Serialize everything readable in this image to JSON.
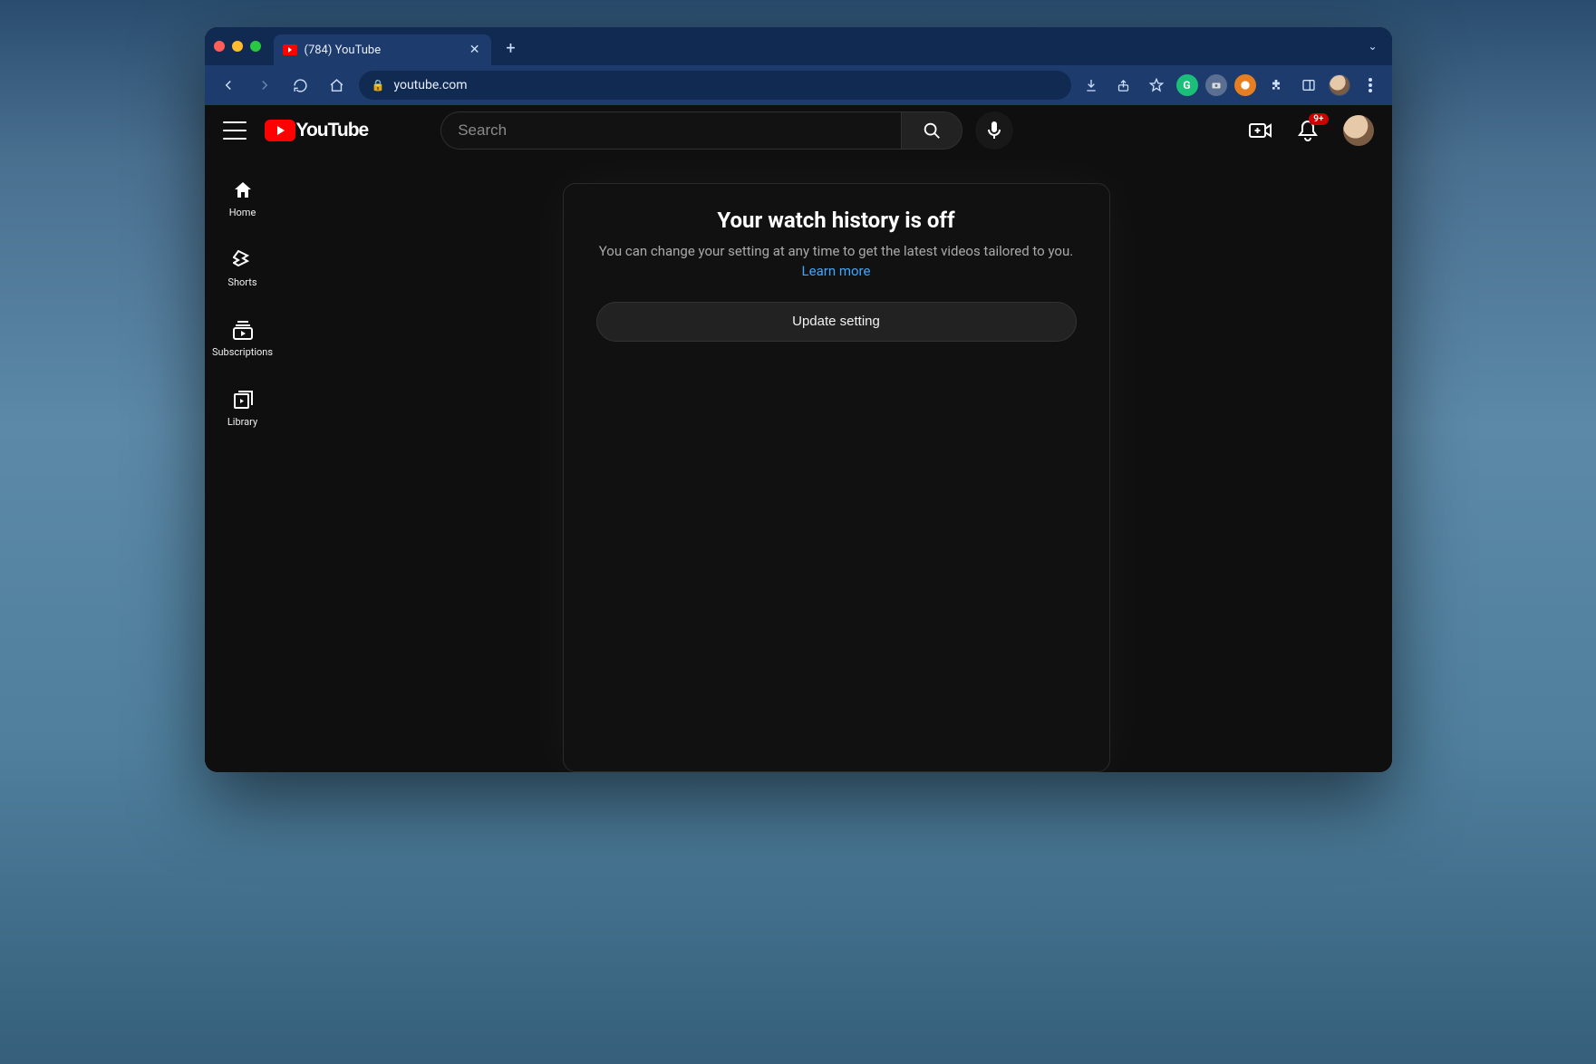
{
  "browser": {
    "tab_title": "(784) YouTube",
    "url": "youtube.com"
  },
  "masthead": {
    "logo_text": "YouTube",
    "search_placeholder": "Search",
    "notification_badge": "9+"
  },
  "sidebar": {
    "items": [
      {
        "label": "Home"
      },
      {
        "label": "Shorts"
      },
      {
        "label": "Subscriptions"
      },
      {
        "label": "Library"
      }
    ]
  },
  "card": {
    "title": "Your watch history is off",
    "body": "You can change your setting at any time to get the latest videos tailored to you. ",
    "learn_more": "Learn more",
    "button": "Update setting"
  }
}
